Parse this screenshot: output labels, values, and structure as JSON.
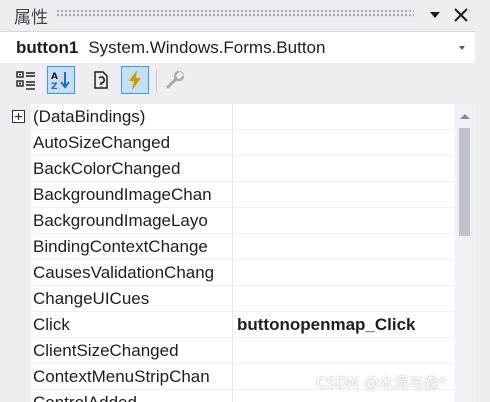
{
  "panel": {
    "title": "属性"
  },
  "selector": {
    "object_name": "button1",
    "object_type": "System.Windows.Forms.Button"
  },
  "toolbar": {
    "buttons": [
      {
        "icon": "categorized-icon",
        "active": false
      },
      {
        "icon": "alphabetical-icon",
        "active": true
      },
      {
        "icon": "properties-icon",
        "active": false
      },
      {
        "icon": "events-lightning-icon",
        "active": true
      },
      {
        "icon": "property-pages-wrench-icon",
        "active": false
      }
    ]
  },
  "grid": {
    "rows": [
      {
        "name": "(DataBindings)",
        "value": "",
        "expandable": true
      },
      {
        "name": "AutoSizeChanged",
        "value": ""
      },
      {
        "name": "BackColorChanged",
        "value": ""
      },
      {
        "name": "BackgroundImageChan",
        "value": ""
      },
      {
        "name": "BackgroundImageLayo",
        "value": ""
      },
      {
        "name": "BindingContextChange",
        "value": ""
      },
      {
        "name": "CausesValidationChang",
        "value": ""
      },
      {
        "name": "ChangeUICues",
        "value": ""
      },
      {
        "name": "Click",
        "value": "buttonopenmap_Click",
        "bold": true
      },
      {
        "name": "ClientSizeChanged",
        "value": ""
      },
      {
        "name": "ContextMenuStripChan",
        "value": ""
      },
      {
        "name": "ControlAdded",
        "value": ""
      }
    ]
  },
  "watermark": "CSDN @木浔与森*",
  "colors": {
    "panel_bg": "#eeeef2",
    "active_tool_bg": "#c5def4",
    "active_tool_border": "#3399ff",
    "lightning": "#d19a00",
    "scroll_thumb": "#c2c3c9"
  }
}
